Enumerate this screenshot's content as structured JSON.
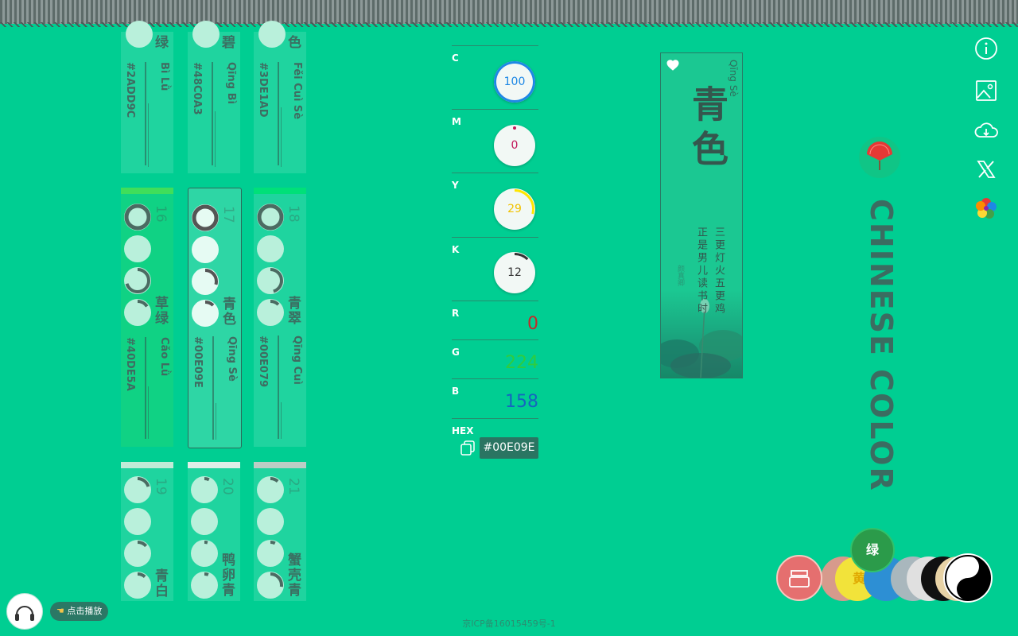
{
  "cards_top": [
    {
      "name_tail": "绿",
      "pinyin": "Bì Lǜ",
      "hex": "#2ADD9C"
    },
    {
      "name_tail": "碧",
      "pinyin": "Qīng Bì",
      "hex": "#48C0A3"
    },
    {
      "name_tail": "色",
      "pinyin": "Fěi Cuì Sè",
      "hex": "#3DE1AD"
    }
  ],
  "cards_mid": [
    {
      "num": "16",
      "name": "草绿",
      "pinyin": "Cǎo Lǜ",
      "hex": "#40DE5A",
      "bar_color": "#40DE5A"
    },
    {
      "num": "17",
      "name": "青色",
      "pinyin": "Qīng Sè",
      "hex": "#00E09E",
      "bar_color": "#00E09E"
    },
    {
      "num": "18",
      "name": "青翠",
      "pinyin": "Qīng Cuì",
      "hex": "#00E079",
      "bar_color": "#00E079"
    }
  ],
  "cards_bottom": [
    {
      "num": "19",
      "name": "青白",
      "bar_color": "#C0EBD7"
    },
    {
      "num": "20",
      "name": "鸭卵青",
      "bar_color": "#E0EEE8"
    },
    {
      "num": "21",
      "name": "蟹壳青",
      "bar_color": "#BBCDC5"
    }
  ],
  "cmyk": [
    {
      "label": "C",
      "value": 100,
      "color": "#1E88E5"
    },
    {
      "label": "M",
      "value": 0,
      "color": "#C2185B"
    },
    {
      "label": "Y",
      "value": 29,
      "color": "#FFE600"
    },
    {
      "label": "K",
      "value": 12,
      "color": "#333333"
    }
  ],
  "rgb": [
    {
      "label": "R",
      "value": "0",
      "color": "#C62828"
    },
    {
      "label": "G",
      "value": "224",
      "color": "#2ECC40"
    },
    {
      "label": "B",
      "value": "158",
      "color": "#1565C0"
    }
  ],
  "hex": {
    "label": "HEX",
    "value": "#00E09E"
  },
  "poem_card": {
    "pinyin": "Qīng Sè",
    "name": "青色",
    "line1": "三更灯火五更鸡",
    "line2": "正是男儿读书时",
    "author": "颜真卿"
  },
  "brand": {
    "title": "CHINESE COLOR"
  },
  "player": {
    "label": "点击播放"
  },
  "bottom_bar": {
    "active": "绿",
    "yellow": "黄"
  },
  "footer": {
    "icp": "京ICP备16015459号-1"
  }
}
